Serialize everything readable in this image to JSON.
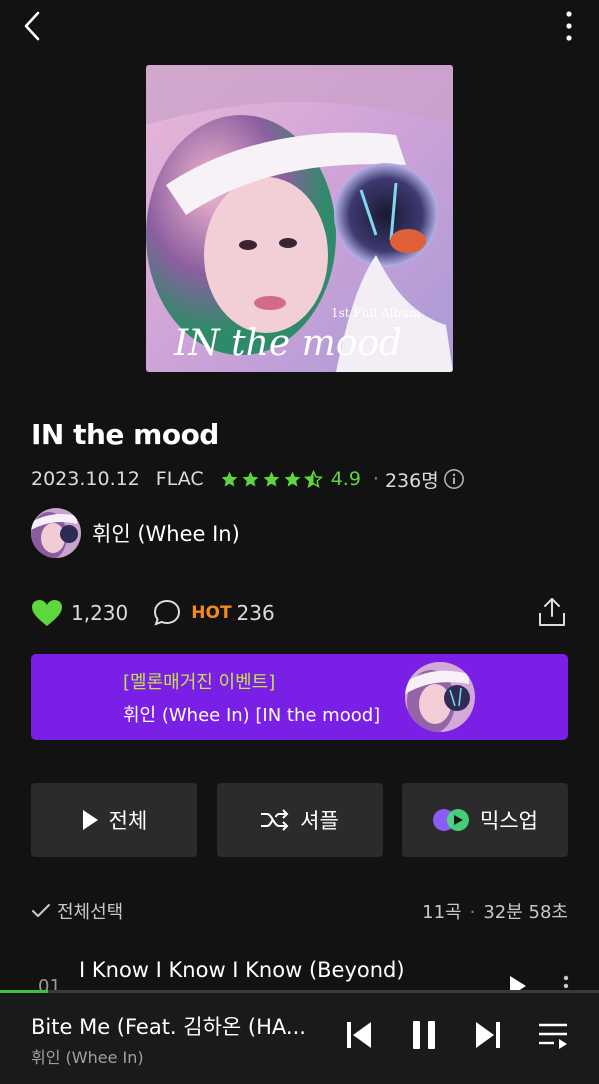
{
  "icons": {
    "back": "chevron-left-icon",
    "more": "more-vertical-icon",
    "info": "info-icon",
    "like": "heart-icon",
    "comment": "comment-icon",
    "share": "share-icon",
    "play": "play-icon",
    "shuffle": "shuffle-icon",
    "mixup": "mixup-icon",
    "check": "check-icon"
  },
  "colors": {
    "accent": "#5ed63d",
    "hot": "#f28a1f",
    "banner_bg": "#7a20e6",
    "banner_tag": "#c7e04a"
  },
  "album": {
    "cover_text_small": "1st Full Album",
    "cover_text_large": "IN the mood",
    "title": "IN the mood",
    "release_date": "2023.10.12",
    "format": "FLAC",
    "rating_stars": 4.5,
    "rating": "4.9",
    "rating_count": "236명"
  },
  "artist": {
    "name": "휘인 (Whee In)"
  },
  "social": {
    "likes": "1,230",
    "hot_label": "HOT",
    "comments": "236"
  },
  "banner": {
    "tag": "[멜론매거진 이벤트]",
    "text": "휘인 (Whee In) [IN the mood]"
  },
  "actions": {
    "play_all": "전체",
    "shuffle": "셔플",
    "mixup": "믹스업"
  },
  "tracklist": {
    "select_all": "전체선택",
    "track_count": "11곡",
    "total_time": "32분 58초",
    "tracks": [
      {
        "number": "01",
        "title": "I Know I Know I Know (Beyond)"
      }
    ]
  },
  "player": {
    "progress": 0.08,
    "title": "Bite Me (Feat. 김하온 (HA...",
    "artist": "휘인 (Whee In)"
  }
}
